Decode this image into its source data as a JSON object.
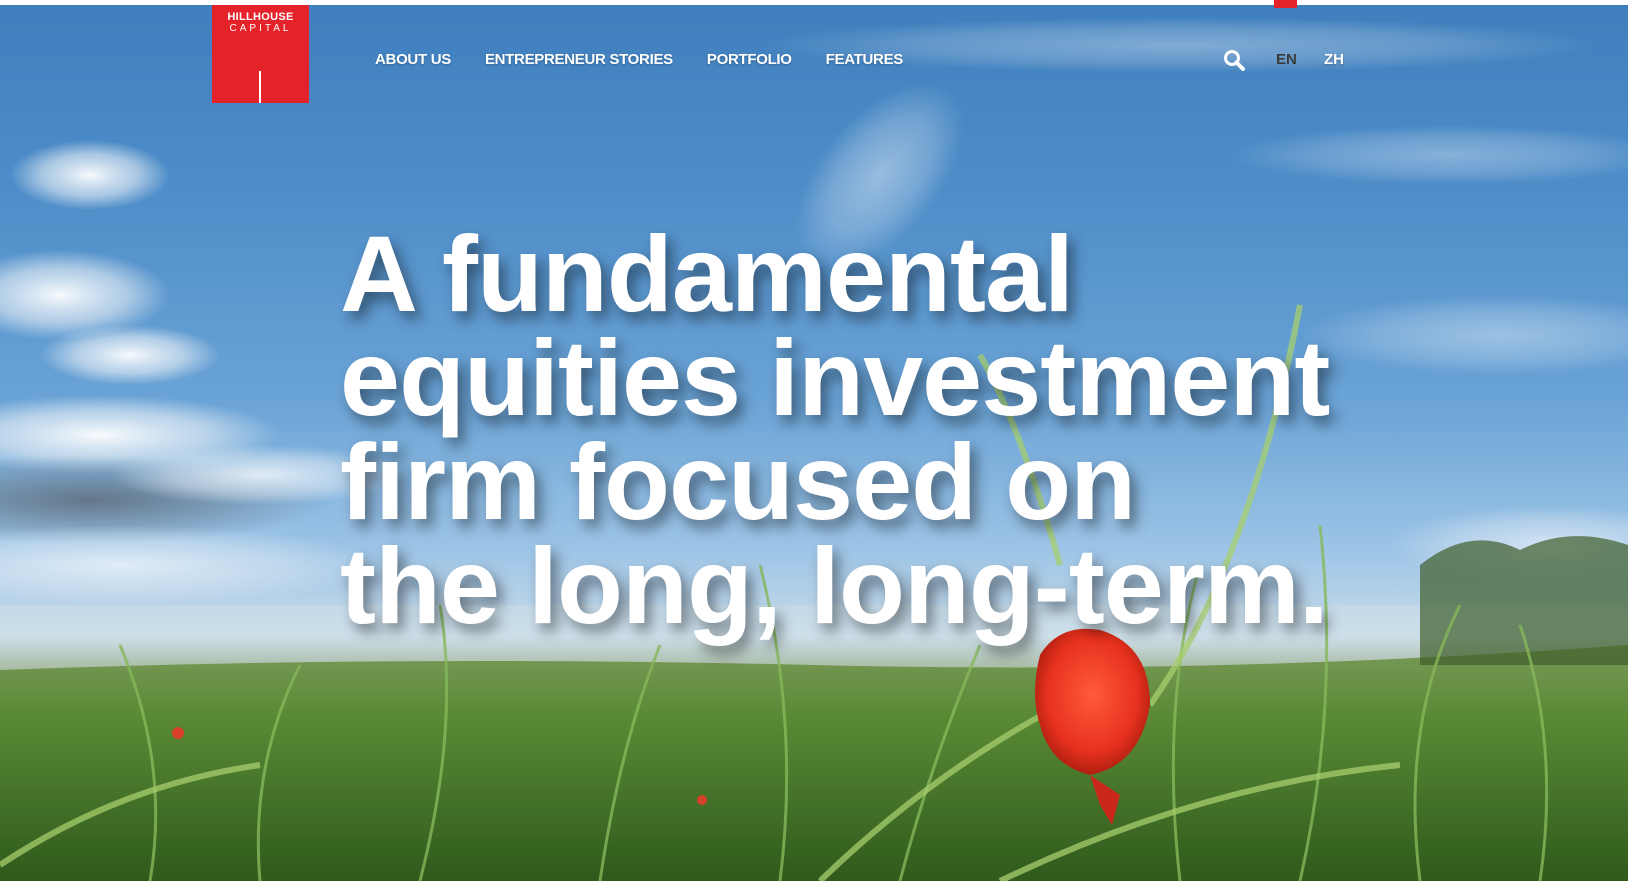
{
  "logo": {
    "line1": "HILLHOUSE",
    "line2": "CAPITAL",
    "color": "#e4222a"
  },
  "nav": {
    "items": [
      {
        "label": "ABOUT US"
      },
      {
        "label": "ENTREPRENEUR STORIES"
      },
      {
        "label": "PORTFOLIO"
      },
      {
        "label": "FEATURES"
      }
    ]
  },
  "search": {
    "icon": "search-icon"
  },
  "languages": {
    "en": "EN",
    "zh": "ZH",
    "selected": "EN"
  },
  "hero": {
    "headline_lines": [
      "A fundamental",
      "equities investment",
      "firm focused on",
      "the long, long-term."
    ]
  },
  "colors": {
    "accent": "#e4222a",
    "text_on_hero": "#ffffff",
    "selected_lang": "#3a3a3a"
  }
}
